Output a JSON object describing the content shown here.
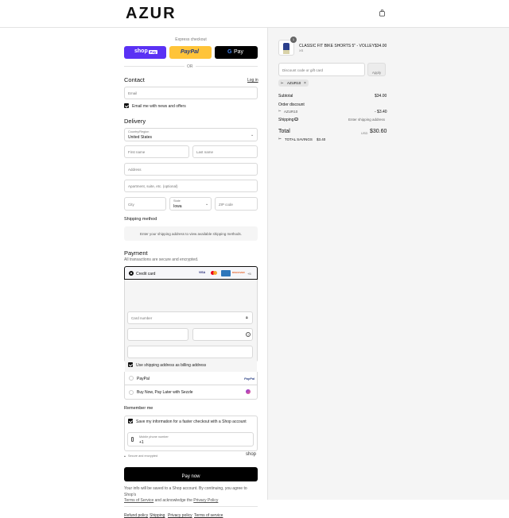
{
  "brand": "AZUR",
  "express": {
    "title": "Express checkout",
    "or": "OR",
    "shop": "shop",
    "shop_pay": "Pay",
    "paypal": "PayPal",
    "gpay": "Pay"
  },
  "contact": {
    "title": "Contact",
    "login": "Log in",
    "email_ph": "Email",
    "news": "Email me with news and offers"
  },
  "delivery": {
    "title": "Delivery",
    "country_label": "Country/Region",
    "country": "United States",
    "first_ph": "First name",
    "last_ph": "Last name",
    "address_ph": "Address",
    "apt_ph": "Apartment, suite, etc. (optional)",
    "city_ph": "City",
    "state_label": "State",
    "state": "Iowa",
    "zip_ph": "ZIP code"
  },
  "shipping": {
    "title": "Shipping method",
    "msg": "Enter your shipping address to view available shipping methods."
  },
  "payment": {
    "title": "Payment",
    "sub": "All transactions are secure and encrypted.",
    "cc": "Credit card",
    "cards": [
      "VISA",
      "MC",
      "AMEX",
      "DISCOVER"
    ],
    "more": "+5",
    "card_ph": "Card number",
    "billing": "Use shipping address as billing address",
    "paypal": "PayPal",
    "paypal_logo": "PayPal",
    "sezzle": "Buy Now, Pay Later with Sezzle"
  },
  "remember": {
    "title": "Remember me",
    "save": "Save my information for a faster checkout with a Shop account",
    "phone_label": "Mobile phone number",
    "phone": "+1",
    "secure": "Secure and encrypted",
    "shop": "shop"
  },
  "pay_btn": "Pay now",
  "legal": {
    "line1": "Your info will be saved to a Shop account. By continuing, you agree to Shop's",
    "tos": "Terms of Service",
    "and": "and acknowledge the",
    "privacy": "Privacy Policy"
  },
  "footer": [
    "Refund policy",
    "Shipping",
    "Privacy policy",
    "Terms of service"
  ],
  "cart": {
    "qty": "1",
    "name": "CLASSIC FIT BIKE SHORTS 5\" - VOLLEY",
    "variant": "XS",
    "price": "$34.00",
    "discount_ph": "Discount code or gift card",
    "apply": "Apply",
    "code": "AZUR10",
    "subtotal_label": "Subtotal",
    "subtotal": "$34.00",
    "od_label": "Order discount",
    "od_code": "AZUR10",
    "od_value": "- $3.40",
    "ship_label": "Shipping",
    "ship_value": "Enter shipping address",
    "total_label": "Total",
    "currency": "USD",
    "total": "$30.60",
    "savings_label": "TOTAL SAVINGS",
    "savings": "$3.40"
  }
}
